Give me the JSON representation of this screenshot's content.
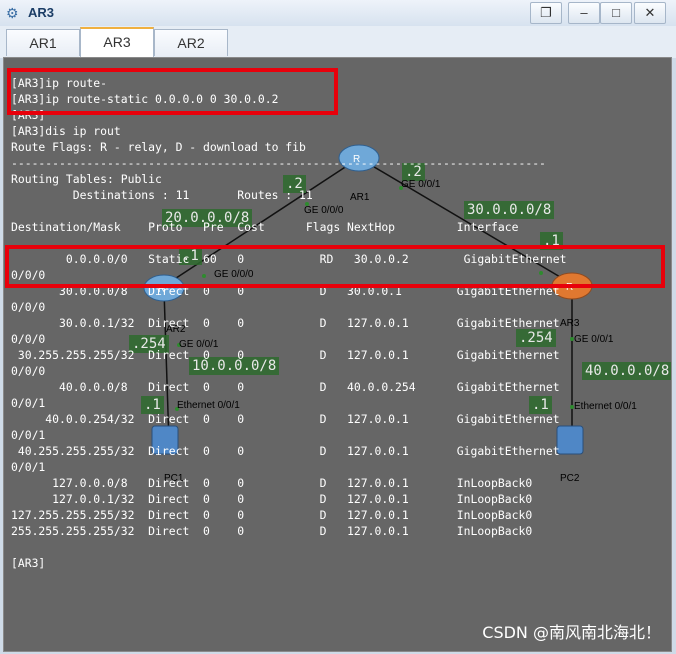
{
  "window": {
    "title": "AR3",
    "controls": [
      "restore-icon",
      "minimize-icon",
      "maximize-icon",
      "close-icon"
    ]
  },
  "tabs": [
    {
      "label": "AR1",
      "active": false
    },
    {
      "label": "AR3",
      "active": true
    },
    {
      "label": "AR2",
      "active": false
    }
  ],
  "terminal": {
    "lines": [
      "[AR3]ip route-",
      "[AR3]ip route-static 0.0.0.0 0 30.0.0.2",
      "[AR3]",
      "[AR3]dis ip rout",
      "Route Flags: R - relay, D - download to fib",
      "------------------------------------------------------------------------------",
      "Routing Tables: Public",
      "         Destinations : 11       Routes : 11",
      "",
      "Destination/Mask    Proto   Pre  Cost      Flags NextHop         Interface",
      "",
      "        0.0.0.0/0   Static  60   0           RD   30.0.0.2        GigabitEthernet",
      "0/0/0",
      "       30.0.0.0/8   Direct  0    0           D   30.0.0.1        GigabitEthernet",
      "0/0/0",
      "       30.0.0.1/32  Direct  0    0           D   127.0.0.1       GigabitEthernet",
      "0/0/0",
      " 30.255.255.255/32  Direct  0    0           D   127.0.0.1       GigabitEthernet",
      "0/0/0",
      "       40.0.0.0/8   Direct  0    0           D   40.0.0.254      GigabitEthernet",
      "0/0/1",
      "     40.0.0.254/32  Direct  0    0           D   127.0.0.1       GigabitEthernet",
      "0/0/1",
      " 40.255.255.255/32  Direct  0    0           D   127.0.0.1       GigabitEthernet",
      "0/0/1",
      "      127.0.0.0/8   Direct  0    0           D   127.0.0.1       InLoopBack0",
      "      127.0.0.1/32  Direct  0    0           D   127.0.0.1       InLoopBack0",
      "127.255.255.255/32  Direct  0    0           D   127.0.0.1       InLoopBack0",
      "255.255.255.255/32  Direct  0    0           D   127.0.0.1       InLoopBack0",
      "",
      "[AR3]"
    ]
  },
  "topology": {
    "nodes": {
      "ar1": "AR1",
      "ar2": "AR2",
      "ar3": "AR3",
      "pc1": "PC1",
      "pc2": "PC2"
    },
    "nets": [
      "20.0.0.0/8",
      "30.0.0.0/8",
      "10.0.0.0/8",
      "40.0.0.0/8"
    ],
    "addr": [
      ".2",
      ".2",
      ".1",
      ".1",
      ".254",
      ".254",
      ".1",
      ".1"
    ],
    "ifaces": [
      "GE 0/0/0",
      "GE 0/0/1",
      "GE 0/0/0",
      "GE 0/0/1",
      "GE 0/0/1",
      "Ethernet 0/0/1",
      "Ethernet 0/0/1"
    ]
  },
  "watermark": "CSDN @南风南北海北！",
  "colors": {
    "terminal_bg": "#666666",
    "highlight": "#e8000b",
    "label_bg": "#2e6b2e"
  }
}
